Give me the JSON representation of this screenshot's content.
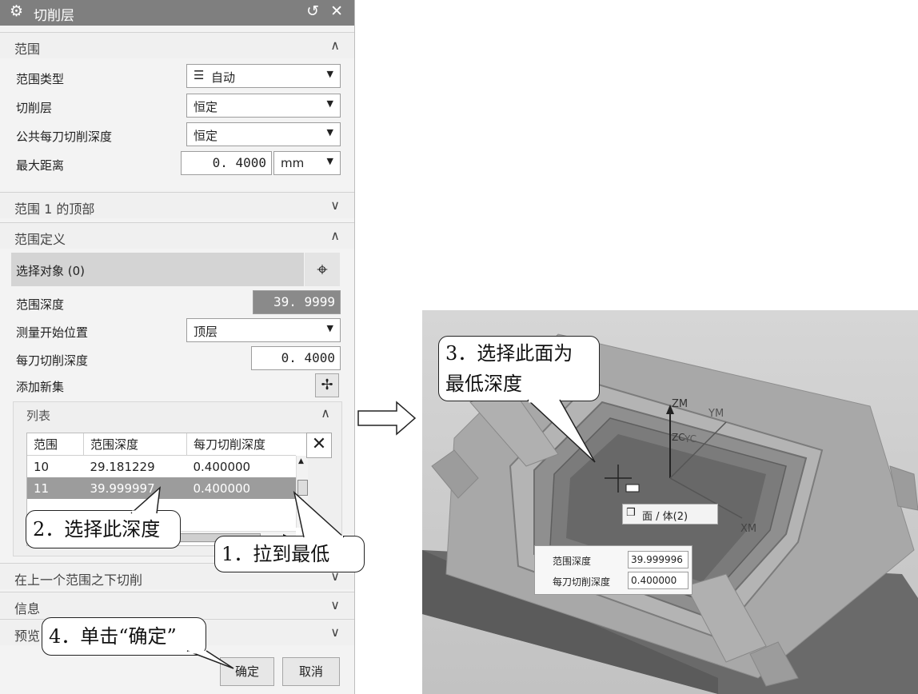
{
  "dialog": {
    "title": "切削层",
    "header_controls": "↺ ✕",
    "sections": {
      "range": "范围",
      "range1_top": "范围 1 的顶部",
      "range_def": "范围定义",
      "cut_below": "在上一个范围之下切削",
      "info": "信息",
      "preview": "预览"
    },
    "fields": {
      "range_type_label": "范围类型",
      "range_type_value": "自动",
      "cut_layer_label": "切削层",
      "cut_layer_value": "恒定",
      "common_depth_label": "公共每刀切削深度",
      "common_depth_value": "恒定",
      "max_dist_label": "最大距离",
      "max_dist_value": "0. 4000",
      "max_dist_unit": "mm",
      "select_obj_label": "选择对象 (0)",
      "range_depth_label": "范围深度",
      "range_depth_value": "39. 9999",
      "measure_start_label": "测量开始位置",
      "measure_start_value": "顶层",
      "per_cut_label": "每刀切削深度",
      "per_cut_value": "0. 4000",
      "add_set_label": "添加新集"
    },
    "list": {
      "title": "列表",
      "headers": [
        "范围",
        "范围深度",
        "每刀切削深度"
      ],
      "rows": [
        [
          "10",
          "29.181229",
          "0.400000"
        ],
        [
          "11",
          "39.999997",
          "0.400000"
        ]
      ]
    },
    "buttons": {
      "ok": "确定",
      "cancel": "取消"
    }
  },
  "callouts": {
    "c1": "1．拉到最低",
    "c2": "2．选择此深度",
    "c3": "3．选择此面为\n最低深度",
    "c4": "4．单击“确定”"
  },
  "view": {
    "axis_zm": "ZM",
    "axis_ym": "YM",
    "axis_xm": "XM",
    "axis_zc": "ZC",
    "axis_yc": "YC",
    "face_tip": "面 / 体(2)",
    "info_depth_label": "范围深度",
    "info_depth_value": "39.999996",
    "info_cut_label": "每刀切削深度",
    "info_cut_value": "0.400000"
  }
}
